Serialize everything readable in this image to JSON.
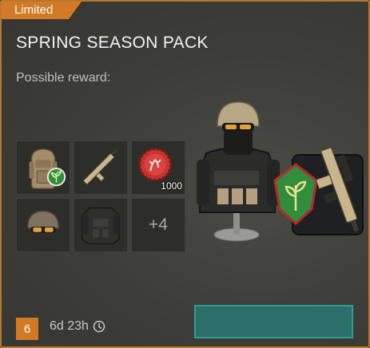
{
  "offer": {
    "tag_label": "Limited",
    "title": "SPRING SEASON PACK",
    "subtitle": "Possible reward:"
  },
  "rewards": {
    "items": [
      {
        "icon": "backpack-icon",
        "badge": "leaf-badge-icon",
        "quantity": ""
      },
      {
        "icon": "rifle-icon",
        "quantity": ""
      },
      {
        "icon": "bottle-cap-icon",
        "quantity": "1000"
      },
      {
        "icon": "helmet-icon",
        "quantity": ""
      },
      {
        "icon": "tactical-vest-icon",
        "quantity": ""
      }
    ],
    "more_label": "+4"
  },
  "footer": {
    "level": "6",
    "time_left": "6d 23h",
    "timer_icon": "clock-icon"
  },
  "colors": {
    "accent_orange": "#d27a25",
    "buy_button_fill": "#2b6e6a",
    "buy_button_border": "#2f9d94"
  }
}
